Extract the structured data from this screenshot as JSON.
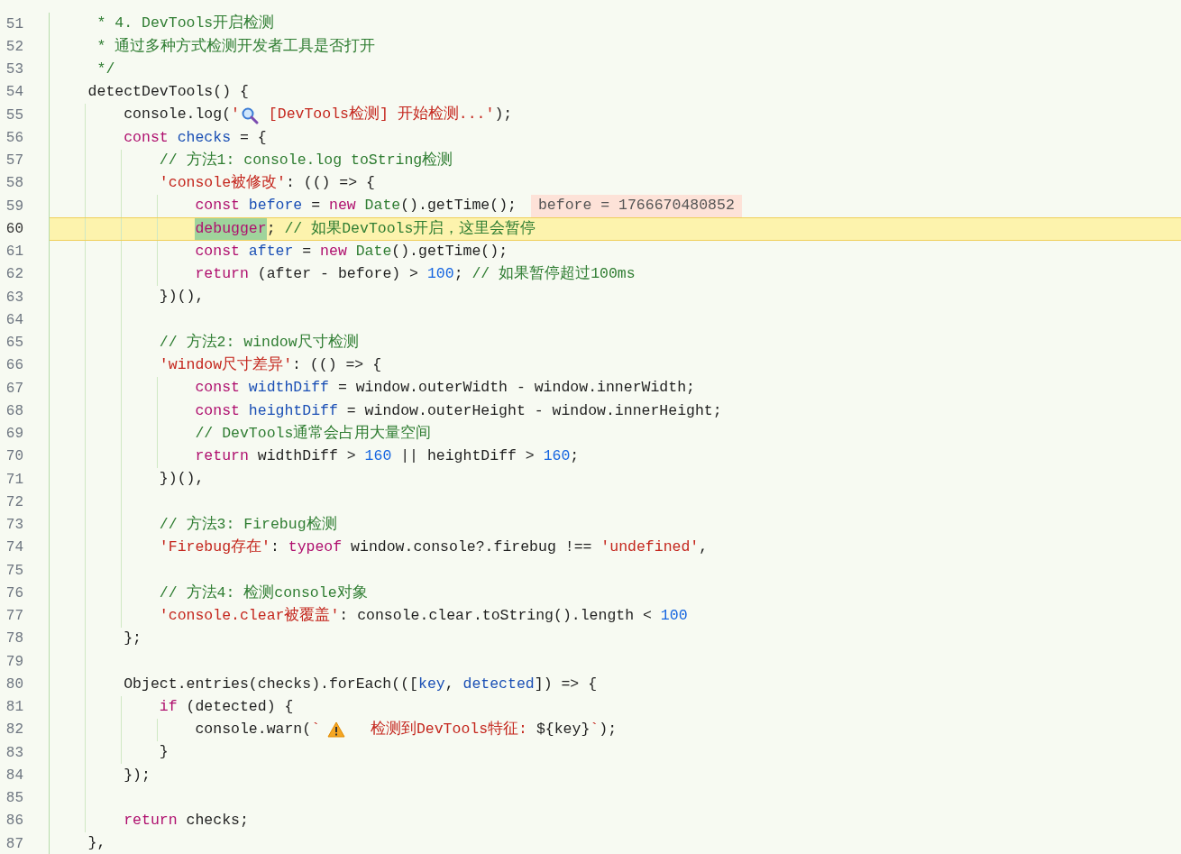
{
  "editor": {
    "lines": [
      {
        "number": "51",
        "current": false,
        "tokens": [
          {
            "kind": "comment",
            "text": "     * 4. DevTools开启检测"
          }
        ]
      },
      {
        "number": "52",
        "current": false,
        "tokens": [
          {
            "kind": "comment",
            "text": "     * 通过多种方式检测开发者工具是否打开"
          }
        ]
      },
      {
        "number": "53",
        "current": false,
        "tokens": [
          {
            "kind": "comment",
            "text": "     */"
          }
        ]
      },
      {
        "number": "54",
        "current": false,
        "tokens": [
          {
            "kind": "plain",
            "text": "    detectDevTools() {"
          }
        ]
      },
      {
        "number": "55",
        "current": false,
        "tokens": [
          {
            "kind": "plain",
            "text": "        console.log("
          },
          {
            "kind": "string",
            "text": "'"
          },
          {
            "kind": "magnifier"
          },
          {
            "kind": "string",
            "text": " [DevTools检测] 开始检测...'"
          },
          {
            "kind": "plain",
            "text": ");"
          }
        ]
      },
      {
        "number": "56",
        "current": false,
        "tokens": [
          {
            "kind": "keyword",
            "text": "        const "
          },
          {
            "kind": "variable",
            "text": "checks"
          },
          {
            "kind": "plain",
            "text": " = {"
          }
        ]
      },
      {
        "number": "57",
        "current": false,
        "tokens": [
          {
            "kind": "comment",
            "text": "            // 方法1: console.log toString检测"
          }
        ]
      },
      {
        "number": "58",
        "current": false,
        "tokens": [
          {
            "kind": "string",
            "text": "            'console被修改'"
          },
          {
            "kind": "plain",
            "text": ": (() => {"
          }
        ]
      },
      {
        "number": "59",
        "current": false,
        "tokens": [
          {
            "kind": "keyword",
            "text": "                const "
          },
          {
            "kind": "variable",
            "text": "before"
          },
          {
            "kind": "plain",
            "text": " = "
          },
          {
            "kind": "keyword",
            "text": "new "
          },
          {
            "kind": "type",
            "text": "Date"
          },
          {
            "kind": "plain",
            "text": "().getTime();"
          },
          {
            "kind": "hint",
            "text": "before = 1766670480852"
          }
        ]
      },
      {
        "number": "60",
        "current": true,
        "tokens": [
          {
            "kind": "debug",
            "text": "                debugger"
          },
          {
            "kind": "plain",
            "text": "; "
          },
          {
            "kind": "comment",
            "text": "// 如果DevTools开启，这里会暂停"
          }
        ]
      },
      {
        "number": "61",
        "current": false,
        "tokens": [
          {
            "kind": "keyword",
            "text": "                const "
          },
          {
            "kind": "variable",
            "text": "after"
          },
          {
            "kind": "plain",
            "text": " = "
          },
          {
            "kind": "keyword",
            "text": "new "
          },
          {
            "kind": "type",
            "text": "Date"
          },
          {
            "kind": "plain",
            "text": "().getTime();"
          }
        ]
      },
      {
        "number": "62",
        "current": false,
        "tokens": [
          {
            "kind": "keyword",
            "text": "                return"
          },
          {
            "kind": "plain",
            "text": " (after - before) > "
          },
          {
            "kind": "number",
            "text": "100"
          },
          {
            "kind": "plain",
            "text": "; "
          },
          {
            "kind": "comment",
            "text": "// 如果暂停超过100ms"
          }
        ]
      },
      {
        "number": "63",
        "current": false,
        "tokens": [
          {
            "kind": "plain",
            "text": "            })(),"
          }
        ]
      },
      {
        "number": "64",
        "current": false
      },
      {
        "number": "65",
        "current": false,
        "tokens": [
          {
            "kind": "comment",
            "text": "            // 方法2: window尺寸检测"
          }
        ]
      },
      {
        "number": "66",
        "current": false,
        "tokens": [
          {
            "kind": "string",
            "text": "            'window尺寸差异'"
          },
          {
            "kind": "plain",
            "text": ": (() => {"
          }
        ]
      },
      {
        "number": "67",
        "current": false,
        "tokens": [
          {
            "kind": "keyword",
            "text": "                const "
          },
          {
            "kind": "variable",
            "text": "widthDiff"
          },
          {
            "kind": "plain",
            "text": " = window.outerWidth - window.innerWidth;"
          }
        ]
      },
      {
        "number": "68",
        "current": false,
        "tokens": [
          {
            "kind": "keyword",
            "text": "                const "
          },
          {
            "kind": "variable",
            "text": "heightDiff"
          },
          {
            "kind": "plain",
            "text": " = window.outerHeight - window.innerHeight;"
          }
        ]
      },
      {
        "number": "69",
        "current": false,
        "tokens": [
          {
            "kind": "comment",
            "text": "                // DevTools通常会占用大量空间"
          }
        ]
      },
      {
        "number": "70",
        "current": false,
        "tokens": [
          {
            "kind": "keyword",
            "text": "                return"
          },
          {
            "kind": "plain",
            "text": " widthDiff > "
          },
          {
            "kind": "number",
            "text": "160"
          },
          {
            "kind": "plain",
            "text": " || heightDiff > "
          },
          {
            "kind": "number",
            "text": "160"
          },
          {
            "kind": "plain",
            "text": ";"
          }
        ]
      },
      {
        "number": "71",
        "current": false,
        "tokens": [
          {
            "kind": "plain",
            "text": "            })(),"
          }
        ]
      },
      {
        "number": "72",
        "current": false
      },
      {
        "number": "73",
        "current": false,
        "tokens": [
          {
            "kind": "comment",
            "text": "            // 方法3: Firebug检测"
          }
        ]
      },
      {
        "number": "74",
        "current": false,
        "tokens": [
          {
            "kind": "string",
            "text": "            'Firebug存在'"
          },
          {
            "kind": "plain",
            "text": ": "
          },
          {
            "kind": "keyword",
            "text": "typeof"
          },
          {
            "kind": "plain",
            "text": " window.console?.firebug !== "
          },
          {
            "kind": "string",
            "text": "'undefined'"
          },
          {
            "kind": "plain",
            "text": ","
          }
        ]
      },
      {
        "number": "75",
        "current": false
      },
      {
        "number": "76",
        "current": false,
        "tokens": [
          {
            "kind": "comment",
            "text": "            // 方法4: 检测console对象"
          }
        ]
      },
      {
        "number": "77",
        "current": false,
        "tokens": [
          {
            "kind": "string",
            "text": "            'console.clear被覆盖'"
          },
          {
            "kind": "plain",
            "text": ": console.clear.toString().length < "
          },
          {
            "kind": "number",
            "text": "100"
          }
        ]
      },
      {
        "number": "78",
        "current": false,
        "tokens": [
          {
            "kind": "plain",
            "text": "        };"
          }
        ]
      },
      {
        "number": "79",
        "current": false
      },
      {
        "number": "80",
        "current": false,
        "tokens": [
          {
            "kind": "plain",
            "text": "        Object.entries(checks).forEach((["
          },
          {
            "kind": "variable",
            "text": "key"
          },
          {
            "kind": "plain",
            "text": ", "
          },
          {
            "kind": "variable",
            "text": "detected"
          },
          {
            "kind": "plain",
            "text": "]) => {"
          }
        ]
      },
      {
        "number": "81",
        "current": false,
        "tokens": [
          {
            "kind": "keyword",
            "text": "            if"
          },
          {
            "kind": "plain",
            "text": " (detected) {"
          }
        ]
      },
      {
        "number": "82",
        "current": false,
        "tokens": [
          {
            "kind": "plain",
            "text": "                console.warn("
          },
          {
            "kind": "string",
            "text": "`"
          },
          {
            "kind": "warning"
          },
          {
            "kind": "string",
            "text": "  检测到DevTools特征: "
          },
          {
            "kind": "plain",
            "text": "${key}"
          },
          {
            "kind": "string",
            "text": "`"
          },
          {
            "kind": "plain",
            "text": ");"
          }
        ]
      },
      {
        "number": "83",
        "current": false,
        "tokens": [
          {
            "kind": "plain",
            "text": "            }"
          }
        ]
      },
      {
        "number": "84",
        "current": false,
        "tokens": [
          {
            "kind": "plain",
            "text": "        });"
          }
        ]
      },
      {
        "number": "85",
        "current": false
      },
      {
        "number": "86",
        "current": false,
        "tokens": [
          {
            "kind": "keyword",
            "text": "        return"
          },
          {
            "kind": "plain",
            "text": " checks;"
          }
        ]
      },
      {
        "number": "87",
        "current": false,
        "tokens": [
          {
            "kind": "plain",
            "text": "    },"
          }
        ]
      }
    ]
  }
}
